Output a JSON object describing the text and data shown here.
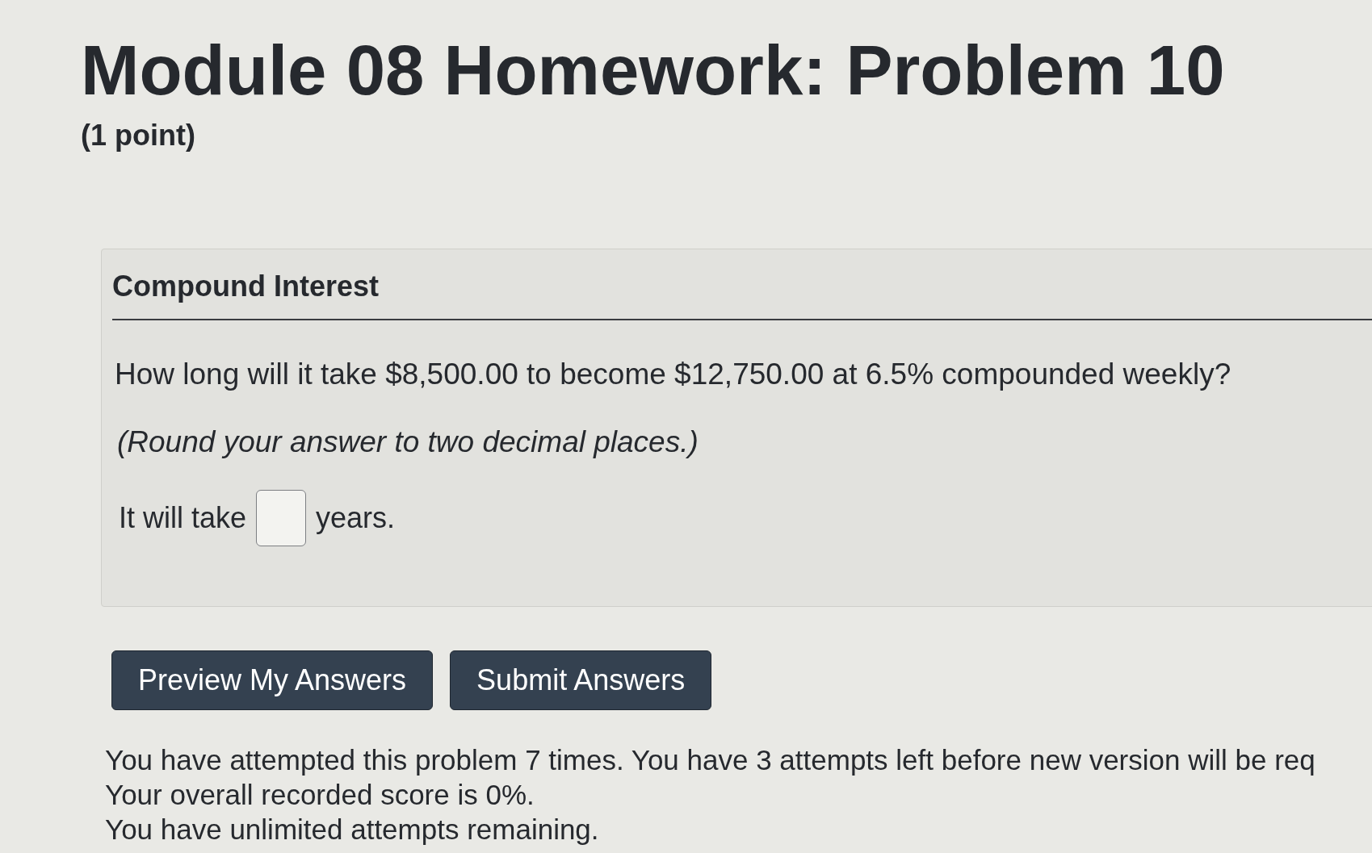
{
  "header": {
    "title": "Module 08 Homework: Problem 10",
    "points": "(1 point)"
  },
  "problem": {
    "heading": "Compound Interest",
    "question": "How long will it take $8,500.00 to become $12,750.00 at 6.5% compounded weekly?",
    "instruction": "(Round your answer to two decimal places.)",
    "answer": {
      "before": "It will take",
      "after": "years."
    }
  },
  "buttons": [
    {
      "label": "Preview My Answers"
    },
    {
      "label": "Submit Answers"
    }
  ],
  "status": [
    "You have attempted this problem 7 times. You have 3 attempts left before new version will be req",
    "Your overall recorded score is 0%.",
    "You have unlimited attempts remaining."
  ]
}
